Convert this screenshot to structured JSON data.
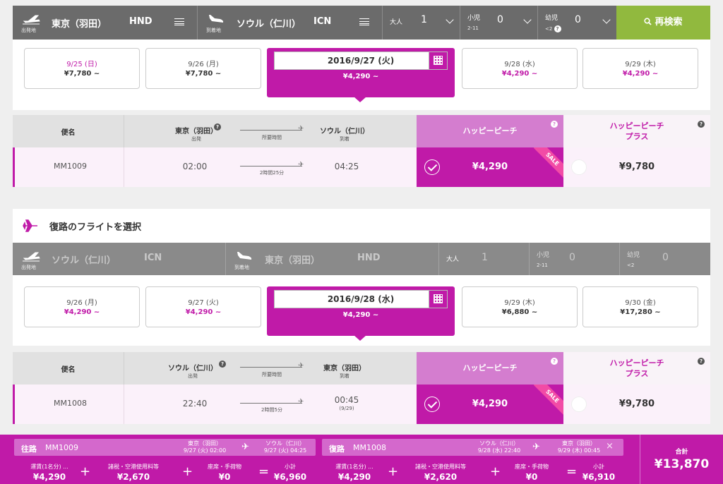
{
  "outbound": {
    "search": {
      "dep_label": "出発地",
      "dep_city": "東京（羽田）",
      "dep_code": "HND",
      "arr_label": "到着地",
      "arr_city": "ソウル（仁川）",
      "arr_code": "ICN",
      "adult_label": "大人",
      "adult_count": "1",
      "child_label": "小児",
      "child_sub": "2-11",
      "child_count": "0",
      "infant_label": "幼児",
      "infant_sub": "<2",
      "infant_count": "0",
      "research_label": "再検索"
    },
    "dates": [
      {
        "date": "9/25 (日)",
        "price": "¥7,780 ~"
      },
      {
        "date": "9/26 (月)",
        "price": "¥7,780 ~"
      },
      {
        "date": "9/28 (水)",
        "price": "¥4,290 ~"
      },
      {
        "date": "9/29 (木)",
        "price": "¥4,290 ~"
      }
    ],
    "selected_date": {
      "date": "2016/9/27 (火)",
      "price": "¥4,290 ~"
    },
    "table": {
      "flight_header": "便名",
      "from_header": "東京（羽田）",
      "from_sub": "出発",
      "duration_header": "所要時間",
      "to_header": "ソウル（仁川）",
      "to_sub": "到着",
      "happy_header": "ハッピーピーチ",
      "plus_header_1": "ハッピーピーチ",
      "plus_header_2": "プラス",
      "help": "?"
    },
    "flight": {
      "number": "MM1009",
      "dep_time": "02:00",
      "duration": "2時間25分",
      "arr_time": "04:25",
      "arr_note": "",
      "happy_price": "¥4,290",
      "plus_price": "¥9,780",
      "sale": "SALE"
    }
  },
  "return_title": "復路のフライトを選択",
  "return": {
    "search": {
      "dep_label": "出発地",
      "dep_city": "ソウル（仁川）",
      "dep_code": "ICN",
      "arr_label": "到着地",
      "arr_city": "東京（羽田）",
      "arr_code": "HND",
      "adult_label": "大人",
      "adult_count": "1",
      "child_label": "小児",
      "child_sub": "2-11",
      "child_count": "0",
      "infant_label": "幼児",
      "infant_sub": "<2",
      "infant_count": "0"
    },
    "dates": [
      {
        "date": "9/26 (月)",
        "price": "¥4,290 ~"
      },
      {
        "date": "9/27 (火)",
        "price": "¥4,290 ~"
      },
      {
        "date": "9/29 (木)",
        "price": "¥6,880 ~"
      },
      {
        "date": "9/30 (金)",
        "price": "¥17,280 ~"
      }
    ],
    "selected_date": {
      "date": "2016/9/28 (水)",
      "price": "¥4,290 ~"
    },
    "table": {
      "flight_header": "便名",
      "from_header": "ソウル（仁川）",
      "from_sub": "出発",
      "duration_header": "所要時間",
      "to_header": "東京（羽田）",
      "to_sub": "到着",
      "happy_header": "ハッピーピーチ",
      "plus_header_1": "ハッピーピーチ",
      "plus_header_2": "プラス",
      "help": "?"
    },
    "flight": {
      "number": "MM1008",
      "dep_time": "22:40",
      "duration": "2時間5分",
      "arr_time": "00:45",
      "arr_note": "(9/29)",
      "happy_price": "¥4,290",
      "plus_price": "¥9,780",
      "sale": "SALE"
    }
  },
  "summary": {
    "out": {
      "label": "往路",
      "flight": "MM1009",
      "from": "東京（羽田）",
      "from_time": "9/27 (火) 02:00",
      "to": "ソウル（仁川）",
      "to_time": "9/27 (火) 04:25",
      "fare_label": "運賃(1名分) ...",
      "fare": "¥4,290",
      "tax_label": "諸税・空港使用料等",
      "tax": "¥2,670",
      "seat_label": "座席・手荷物",
      "seat": "¥0",
      "subtotal_label": "小計",
      "subtotal": "¥6,960"
    },
    "ret": {
      "label": "復路",
      "flight": "MM1008",
      "from": "ソウル（仁川）",
      "from_time": "9/28 (水) 22:40",
      "to": "東京（羽田）",
      "to_time": "9/29 (木) 00:45",
      "fare_label": "運賃(1名分) ...",
      "fare": "¥4,290",
      "tax_label": "諸税・空港使用料等",
      "tax": "¥2,620",
      "seat_label": "座席・手荷物",
      "seat": "¥0",
      "subtotal_label": "小計",
      "subtotal": "¥6,910"
    },
    "total_label": "合計",
    "total": "¥13,870",
    "plus": "+",
    "equals": "="
  },
  "colors": {
    "accent": "#c01aa8",
    "green": "#91b93e",
    "bar": "#6b6b6b"
  }
}
